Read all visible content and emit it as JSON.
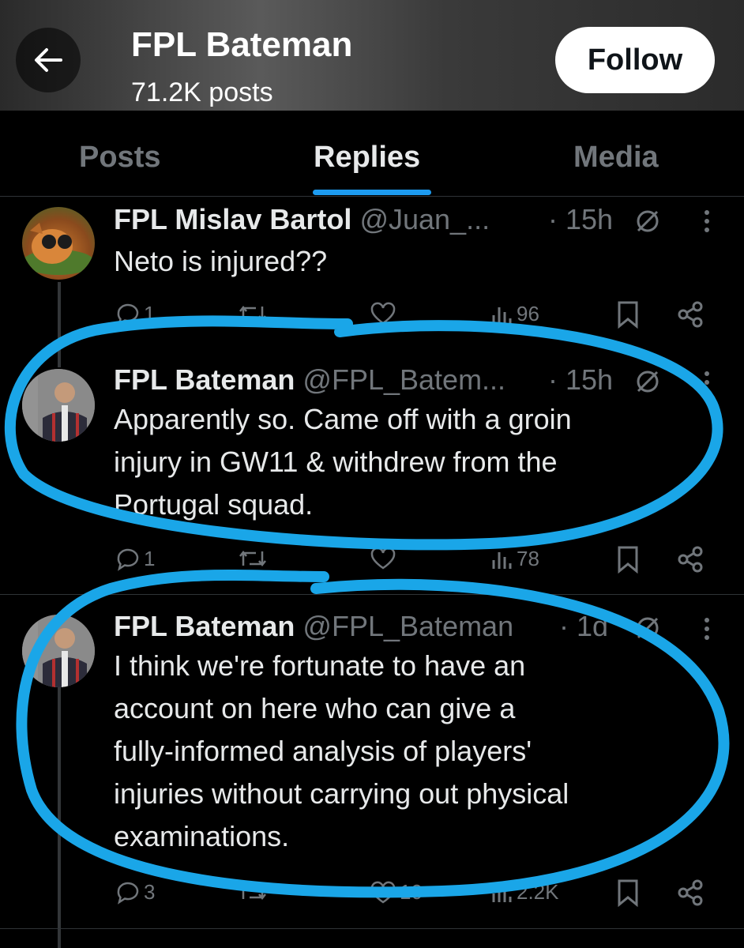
{
  "header": {
    "title": "FPL Bateman",
    "subtitle": "71.2K posts",
    "follow_label": "Follow"
  },
  "tabs": [
    {
      "label": "Posts"
    },
    {
      "label": "Replies"
    },
    {
      "label": "Media"
    }
  ],
  "posts": [
    {
      "name": "FPL Mislav Bartol",
      "handle": "@Juan_...",
      "time": "· 15h",
      "text": "Neto is injured??",
      "replies": "1",
      "views": "96"
    },
    {
      "name": "FPL Bateman",
      "handle": "@FPL_Batem...",
      "time": "· 15h",
      "text_lines": [
        "Apparently so. Came off with a groin",
        "injury in GW11 & withdrew from the",
        "Portugal squad."
      ],
      "replies": "1",
      "views": "78"
    },
    {
      "name": "FPL Bateman",
      "handle": "@FPL_Bateman",
      "time": "· 1d",
      "text_lines": [
        "I think we're fortunate to have an",
        "account on here who can give a",
        "fully-informed analysis of players'",
        "injuries without carrying out physical",
        "examinations."
      ],
      "replies": "3",
      "likes": "10",
      "views": "2.2K"
    }
  ],
  "colors": {
    "accent": "#1d9bf0",
    "annotation": "#1aa6e8",
    "muted": "#71767b"
  }
}
